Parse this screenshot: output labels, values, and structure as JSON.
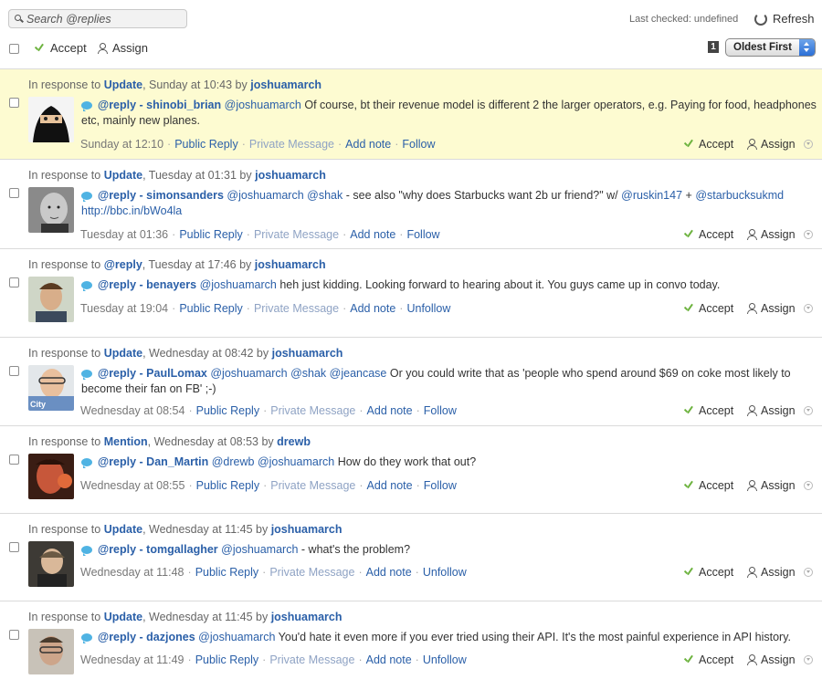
{
  "toolbar": {
    "search_placeholder": "Search @replies",
    "last_checked": "Last checked: undefined",
    "refresh_label": "Refresh",
    "accept_label": "Accept",
    "assign_label": "Assign",
    "page_number": "1",
    "sort_selected": "Oldest First"
  },
  "labels": {
    "public_reply": "Public Reply",
    "private_message": "Private Message",
    "add_note": "Add note",
    "accept": "Accept",
    "assign": "Assign"
  },
  "colors": {
    "highlight": "#fdfbd1",
    "link": "#2a5fa8",
    "accept_check": "#6db33f",
    "reply_bubble": "#4fb3e3"
  },
  "items": [
    {
      "highlighted": true,
      "resp_prefix": "In response to",
      "resp_type": "Update",
      "resp_time": ", Sunday at 10:43 by",
      "resp_user": "joshuamarch",
      "reply_label": "@reply - shinobi_brian",
      "mention": "@joshuamarch",
      "text": "Of course, bt their revenue model is different 2 the larger operators, e.g. Paying for food, headphones etc, mainly new planes.",
      "time": "Sunday at 12:10",
      "follow": "Follow"
    },
    {
      "highlighted": false,
      "resp_prefix": "In response to",
      "resp_type": "Update",
      "resp_time": ", Tuesday at 01:31 by",
      "resp_user": "joshuamarch",
      "reply_label": "@reply - simonsanders",
      "mention": "@joshuamarch @shak",
      "text": "- see also \"why does Starbucks want 2b ur friend?\" w/",
      "extra_links": [
        "@ruskin147",
        "+",
        "@starbucksukmd",
        "http://bbc.in/bWo4la"
      ],
      "time": "Tuesday at 01:36",
      "follow": "Follow"
    },
    {
      "highlighted": false,
      "resp_prefix": "In response to",
      "resp_type": "@reply",
      "resp_time": ", Tuesday at 17:46 by",
      "resp_user": "joshuamarch",
      "reply_label": "@reply - benayers",
      "mention": "@joshuamarch",
      "text": "heh just kidding. Looking forward to hearing about it. You guys came up in convo today.",
      "time": "Tuesday at 19:04",
      "follow": "Unfollow"
    },
    {
      "highlighted": false,
      "resp_prefix": "In response to",
      "resp_type": "Update",
      "resp_time": ", Wednesday at 08:42 by",
      "resp_user": "joshuamarch",
      "reply_label": "@reply - PaulLomax",
      "mention": "@joshuamarch @shak @jeancase",
      "text": "Or you could write that as 'people who spend around $69 on coke most likely to become their fan on FB' ;-)",
      "time": "Wednesday at 08:54",
      "follow": "Follow",
      "avatar_caption": "City"
    },
    {
      "highlighted": false,
      "resp_prefix": "In response to",
      "resp_type": "Mention",
      "resp_time": ", Wednesday at 08:53 by",
      "resp_user": "drewb",
      "reply_label": "@reply - Dan_Martin",
      "mention": "@drewb @joshuamarch",
      "text": "How do they work that out?",
      "time": "Wednesday at 08:55",
      "follow": "Follow"
    },
    {
      "highlighted": false,
      "resp_prefix": "In response to",
      "resp_type": "Update",
      "resp_time": ", Wednesday at 11:45 by",
      "resp_user": "joshuamarch",
      "reply_label": "@reply - tomgallagher",
      "mention": "@joshuamarch",
      "text": "- what's the problem?",
      "time": "Wednesday at 11:48",
      "follow": "Unfollow"
    },
    {
      "highlighted": false,
      "resp_prefix": "In response to",
      "resp_type": "Update",
      "resp_time": ", Wednesday at 11:45 by",
      "resp_user": "joshuamarch",
      "reply_label": "@reply - dazjones",
      "mention": "@joshuamarch",
      "text": "You'd hate it even more if you ever tried using their API. It's the most painful experience in API history.",
      "time": "Wednesday at 11:49",
      "follow": "Unfollow"
    }
  ]
}
